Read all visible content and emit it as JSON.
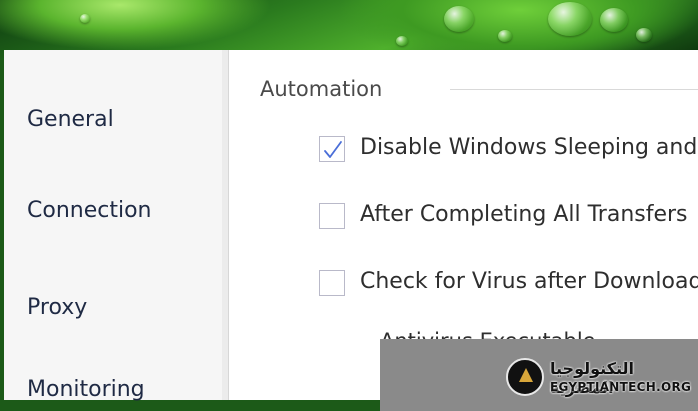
{
  "sidebar": {
    "items": [
      {
        "label": "General"
      },
      {
        "label": "Connection"
      },
      {
        "label": "Proxy"
      },
      {
        "label": "Monitoring"
      }
    ]
  },
  "automation": {
    "section_title": "Automation",
    "options": [
      {
        "label": "Disable Windows Sleeping and I",
        "checked": true
      },
      {
        "label": "After Completing All Transfers",
        "checked": false
      },
      {
        "label": "Check for Virus after Download",
        "checked": false
      }
    ],
    "antivirus_label": "Antivirus Executable",
    "antivirus_value": ""
  },
  "watermark": {
    "arabic": "التكنولوجيا المصرية",
    "english": "EGYPTIANTECH.ORG"
  },
  "colors": {
    "check_mark": "#4a6ed8",
    "banner_green": "#3e9a22"
  }
}
